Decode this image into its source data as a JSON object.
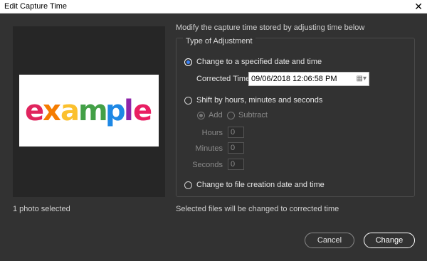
{
  "window": {
    "title": "Edit Capture Time",
    "close_glyph": "✕"
  },
  "preview": {
    "thumbnail_text": "example",
    "selection_count": "1 photo selected"
  },
  "instructions": "Modify the capture time stored by adjusting time below",
  "adjustment": {
    "legend": "Type of Adjustment",
    "option_specified": "Change to a specified date and time",
    "corrected_time_label": "Corrected Time",
    "corrected_time_value": "09/06/2018  12:06:58 PM",
    "calendar_glyph": "▦▾",
    "option_shift": "Shift by hours, minutes and seconds",
    "add_label": "Add",
    "subtract_label": "Subtract",
    "hours_label": "Hours",
    "hours_value": "0",
    "minutes_label": "Minutes",
    "minutes_value": "0",
    "seconds_label": "Seconds",
    "seconds_value": "0",
    "option_file_date": "Change to file creation date and time"
  },
  "footer_note": "Selected files will be changed to corrected time",
  "buttons": {
    "cancel": "Cancel",
    "change": "Change"
  }
}
